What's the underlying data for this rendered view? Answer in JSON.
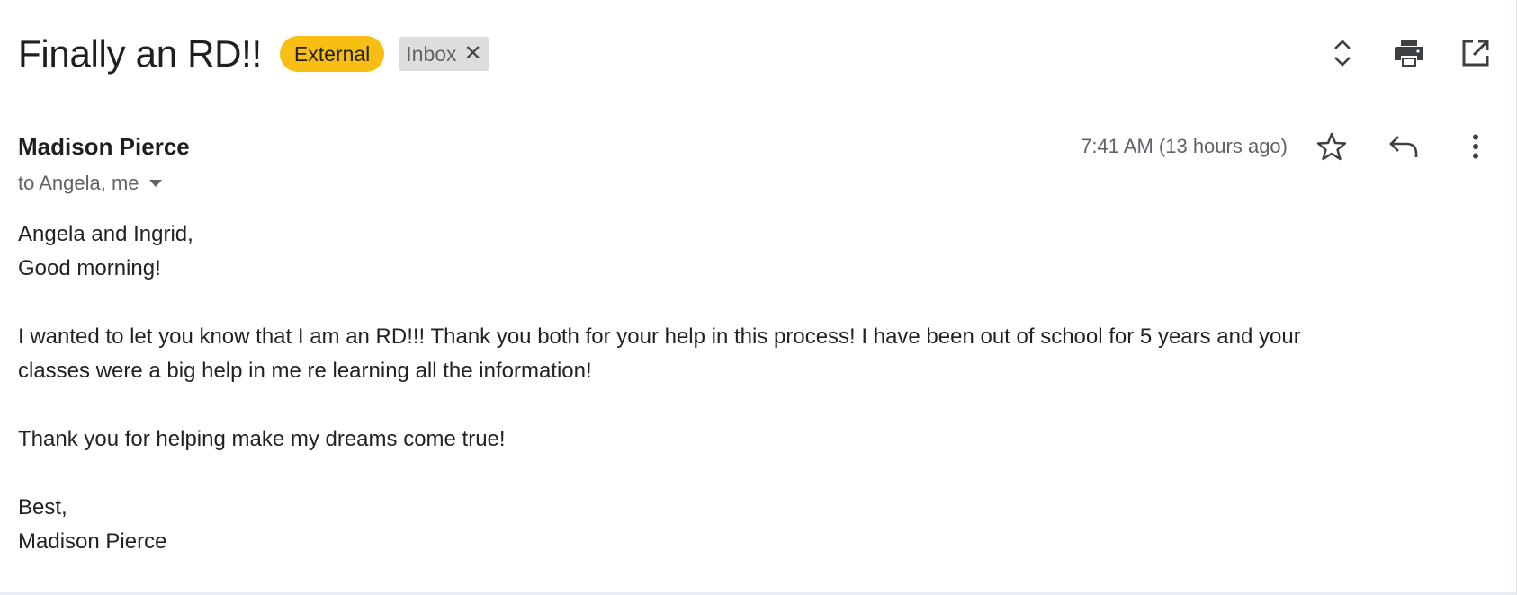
{
  "header": {
    "subject": "Finally an RD!!",
    "labels": {
      "external": "External",
      "inbox": "Inbox",
      "inbox_remove": "✕"
    },
    "actions": [
      "expand-collapse-icon",
      "print-icon",
      "open-in-new-window-icon"
    ]
  },
  "message": {
    "sender": "Madison Pierce",
    "recipients": "to Angela, me",
    "timestamp": "7:41 AM (13 hours ago)",
    "actions": [
      "star-icon",
      "reply-icon",
      "more-vert-icon"
    ],
    "body": {
      "greeting": "Angela and Ingrid,",
      "line2": "Good morning!",
      "para1_line1": "I wanted to let you know that I am an RD!!! Thank you both for your help in this process! I have been out of school for 5 years and your",
      "para1_line2": "classes were a big help in me re learning all the information!",
      "para2": "Thank you for helping make my dreams come true!",
      "closing": "Best,",
      "signature": "Madison Pierce"
    }
  },
  "colors": {
    "external_label": "#f8be14",
    "inbox_label": "#dddddd",
    "text_primary": "#1f1f1f",
    "text_secondary": "#5f6368"
  }
}
